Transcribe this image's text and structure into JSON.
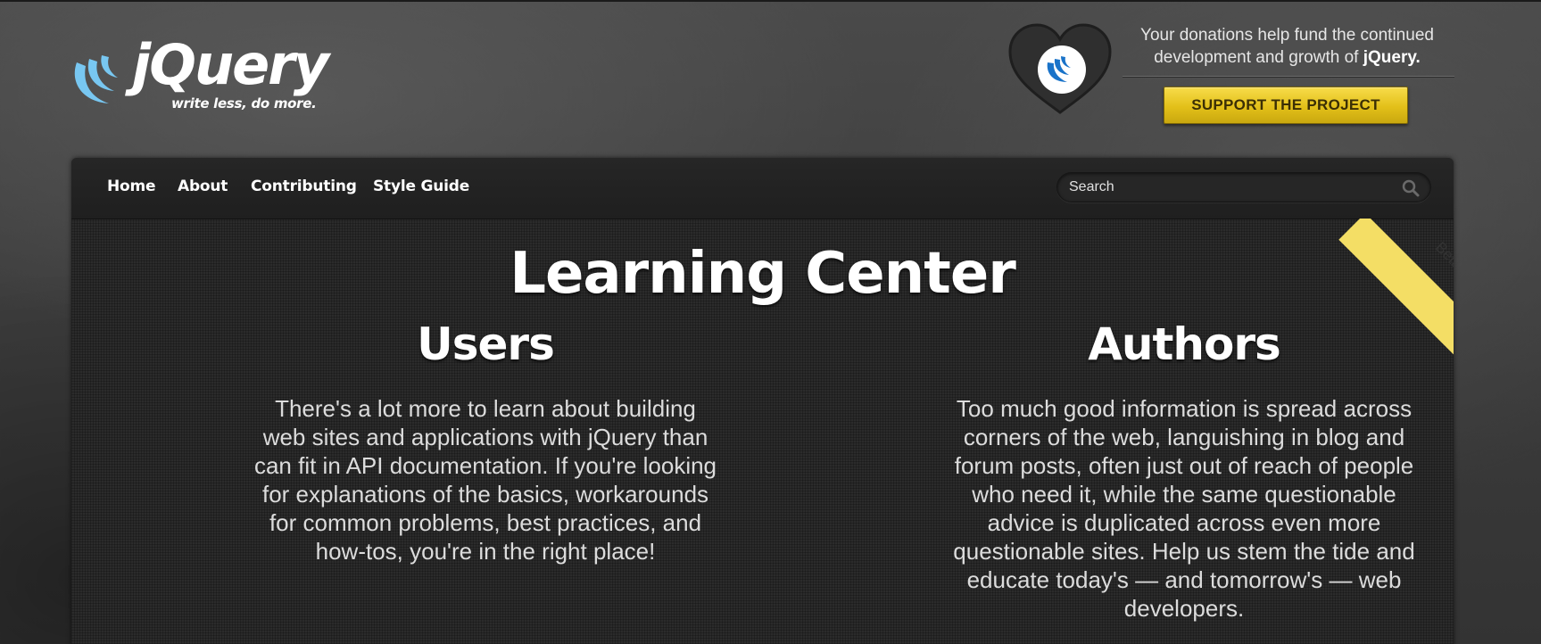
{
  "brand": {
    "name": "jQuery",
    "tagline": "write less, do more."
  },
  "donation": {
    "text_prefix": "Your donations help fund the continued development and growth of ",
    "text_emphasis": "jQuery.",
    "button_label": "SUPPORT THE PROJECT"
  },
  "nav": {
    "items": [
      {
        "label": "Home"
      },
      {
        "label": "About"
      },
      {
        "label": "Contributing"
      },
      {
        "label": "Style Guide"
      }
    ]
  },
  "search": {
    "placeholder": "Search",
    "value": ""
  },
  "ribbon": {
    "label": "Beta"
  },
  "main": {
    "title": "Learning Center",
    "columns": [
      {
        "heading": "Users",
        "text": "There's a lot more to learn about building web sites and applications with jQuery than can fit in API documentation. If you're looking for explanations of the basics, workarounds for common problems, best practices, and how-tos, you're in the right place!"
      },
      {
        "heading": "Authors",
        "text": "Too much good information is spread across corners of the web, languishing in blog and forum posts, often just out of reach of people who need it, while the same questionable advice is duplicated across even more questionable sites. Help us stem the tide and educate today's — and tomorrow's — web developers."
      }
    ]
  },
  "colors": {
    "accent_yellow": "#e3c019",
    "ribbon_yellow": "#f4de65",
    "logo_blue": "#78c7f1",
    "panel_bg": "#2b2b2b"
  }
}
